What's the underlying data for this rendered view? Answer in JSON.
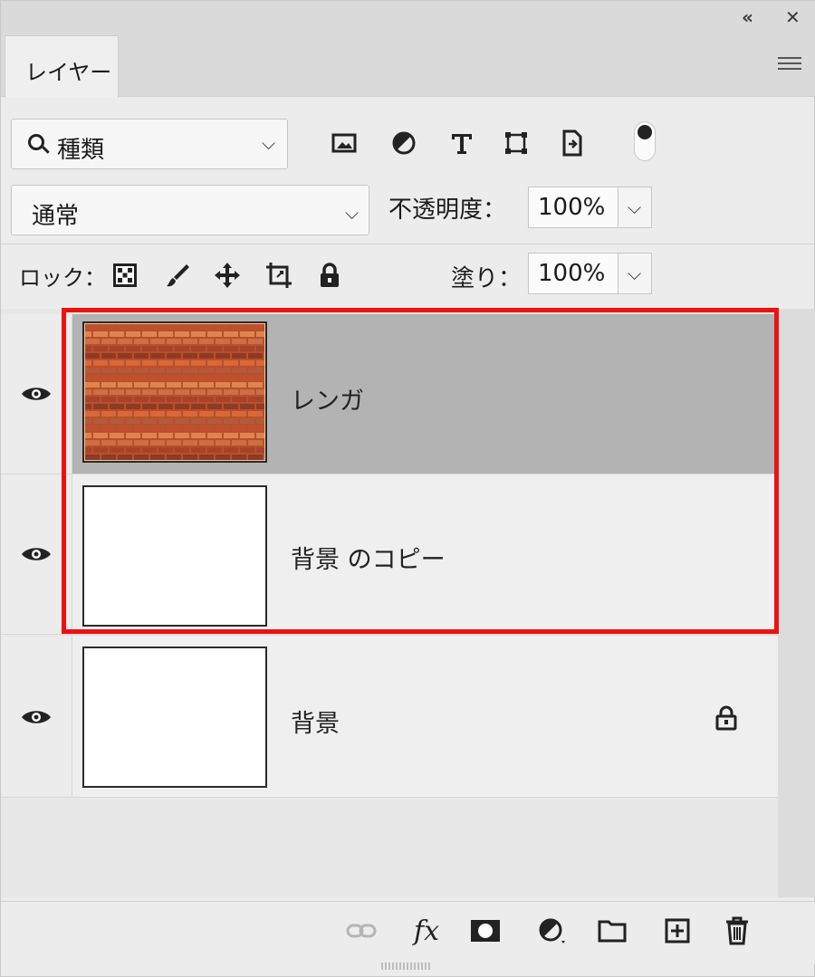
{
  "panel": {
    "collapse_glyph": "«",
    "close_glyph": "✕",
    "tab_label": "レイヤー"
  },
  "filter": {
    "label": "種類",
    "icons": [
      "image-filter-icon",
      "adjustment-filter-icon",
      "type-filter-icon",
      "shape-filter-icon",
      "smart-object-filter-icon"
    ]
  },
  "blend": {
    "mode": "通常",
    "opacity_label": "不透明度：",
    "opacity_value": "100%"
  },
  "lock": {
    "label": "ロック：",
    "fill_label": "塗り：",
    "fill_value": "100%"
  },
  "layers": [
    {
      "name": "レンガ",
      "selected": true,
      "thumbnail": "brick",
      "locked": false
    },
    {
      "name": "背景 のコピー",
      "selected": false,
      "thumbnail": "white",
      "locked": false
    },
    {
      "name": "背景",
      "selected": false,
      "thumbnail": "white",
      "locked": true
    }
  ],
  "colors": {
    "highlight": "#ee1111",
    "selected_row": "#b3b3b3",
    "panel_bg": "#ececec"
  }
}
